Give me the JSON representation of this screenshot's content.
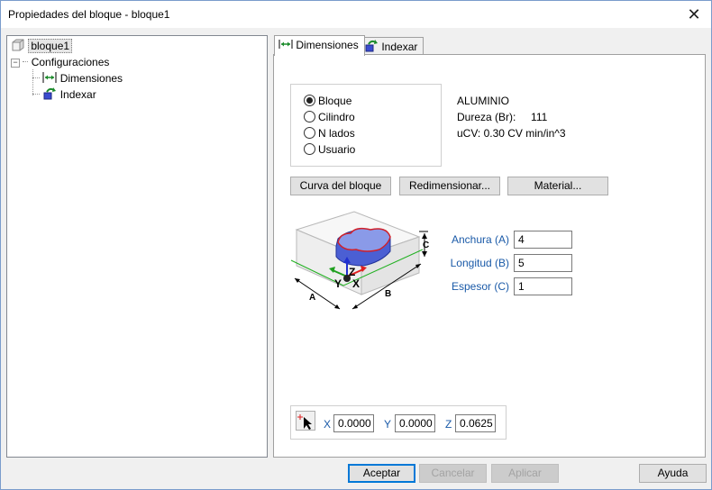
{
  "window": {
    "title": "Propiedades del bloque - bloque1",
    "close_glyph": "✕"
  },
  "tree": {
    "root_label": "bloque1",
    "config_label": "Configuraciones",
    "collapse_glyph": "−",
    "items": [
      {
        "label": "Dimensiones"
      },
      {
        "label": "Indexar"
      }
    ]
  },
  "tabs": [
    {
      "label": "Dimensiones",
      "active": true
    },
    {
      "label": "Indexar",
      "active": false
    }
  ],
  "shape": {
    "options": [
      "Bloque",
      "Cilindro",
      "N lados",
      "Usuario"
    ],
    "selected": "Bloque"
  },
  "material": {
    "name": "ALUMINIO",
    "hardness_label": "Dureza (Br):",
    "hardness_value": "111",
    "ucv": "uCV: 0.30 CV min/in^3"
  },
  "buttons": {
    "curve": "Curva del bloque",
    "resize": "Redimensionar...",
    "material": "Material..."
  },
  "diagram": {
    "label_a": "A",
    "label_b": "B",
    "label_c": "C",
    "axis_x": "X",
    "axis_y": "Y",
    "axis_z": "Z"
  },
  "dimensions": {
    "width_label": "Anchura (A)",
    "width_value": "4",
    "length_label": "Longitud (B)",
    "length_value": "5",
    "thickness_label": "Espesor (C)",
    "thickness_value": "1"
  },
  "origin": {
    "x_label": "X",
    "x_value": "0.0000",
    "y_label": "Y",
    "y_value": "0.0000",
    "z_label": "Z",
    "z_value": "0.0625"
  },
  "footer": {
    "accept": "Aceptar",
    "cancel": "Cancelar",
    "apply": "Aplicar",
    "help": "Ayuda"
  },
  "colors": {
    "accent": "#0078d7",
    "dim_label": "#1a5aa8",
    "axis_x": "#e02020",
    "axis_y": "#20a020",
    "axis_z": "#2030d0"
  }
}
